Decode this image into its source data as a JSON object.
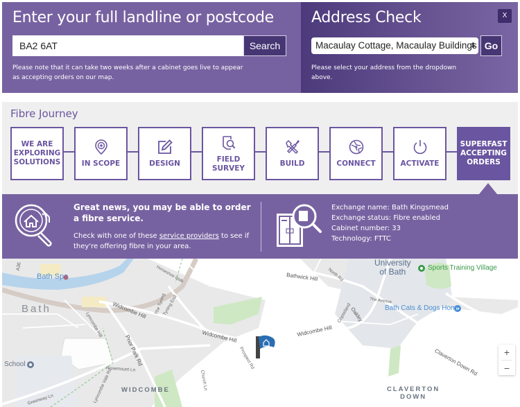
{
  "search": {
    "title": "Enter your full landline or postcode",
    "input_value": "BA2 6AT",
    "button_label": "Search",
    "note": "Please note that it can take two weeks after a cabinet goes live to appear as accepting orders on our map."
  },
  "address": {
    "title": "Address Check",
    "close_label": "X",
    "selected_address": "Macaulay Cottage, Macaulay Buildings",
    "go_label": "Go",
    "note": "Please select your address from the dropdown above."
  },
  "journey": {
    "title": "Fibre Journey",
    "steps": [
      {
        "label": "WE ARE\nEXPLORING\nSOLUTIONS",
        "icon": "none"
      },
      {
        "label": "IN SCOPE",
        "icon": "location-pin-plus-icon"
      },
      {
        "label": "DESIGN",
        "icon": "edit-pencil-icon"
      },
      {
        "label": "FIELD\nSURVEY",
        "icon": "document-search-icon"
      },
      {
        "label": "BUILD",
        "icon": "tools-icon"
      },
      {
        "label": "CONNECT",
        "icon": "globe-network-icon"
      },
      {
        "label": "ACTIVATE",
        "icon": "power-icon"
      },
      {
        "label": "SUPERFAST\nACCEPTING\nORDERS",
        "icon": "none",
        "active": true
      }
    ]
  },
  "result": {
    "headline": "Great news, you may be able to order a fibre service.",
    "body_prefix": "Check with one of these ",
    "body_link": "service providers",
    "body_suffix": " to see if they're offering fibre in your area.",
    "exchange_name": "Exchange name: Bath Kingsmead",
    "exchange_status": "Exchange status: Fibre enabled",
    "cabinet_number": "Cabinet number: 33",
    "technology": "Technology: FTTC"
  },
  "map": {
    "labels": {
      "bath_spa": "Bath Spa",
      "bath": "Bath",
      "university": "University\nof Bath",
      "sports": "Sports Training Village",
      "cats_dogs": "Bath Cats & Dogs Home",
      "school": "School",
      "widcombe": "WIDCOMBE",
      "claverton_down": "CLAVERTON\nDOWN",
      "widcombe_hill_1": "Widcombe Hill",
      "widcombe_hill_2": "Widcombe Hill",
      "widcombe_hill_3": "Widcombe Hill",
      "bathwick_hill": "Bathwick Hill",
      "claverton_down_rd": "Claverton Down Rd",
      "prior_park_rd": "Prior Park Rd",
      "north_rd": "North Rd",
      "oakley": "Oakley",
      "the_avenue": "The Avenue",
      "horseshoe_walk": "Horseshoe Walk",
      "the_tyning": "The Tyning",
      "tyning_end": "Tyning End",
      "copseland": "Copseland",
      "rosemount_ln": "Rosemount Ln",
      "greenway_ln": "Greenway Ln",
      "lyncombe_hill": "Lyncombe Hill",
      "lyncombe_vale_rd": "Lyncombe Vale Rd",
      "church_ln": "Church Ln",
      "prospect_rd": "Prospect Rd",
      "a36": "A36"
    },
    "zoom_in": "+",
    "zoom_out": "−",
    "colors": {
      "poi_blue": "#4a8fd6",
      "poi_green": "#3a9a4a",
      "label_gray": "#6a7380"
    }
  },
  "colors": {
    "brand_purple": "#7762a1",
    "dark_purple": "#473674",
    "step_purple": "#6a55a0",
    "journey_bg": "#efefef"
  }
}
